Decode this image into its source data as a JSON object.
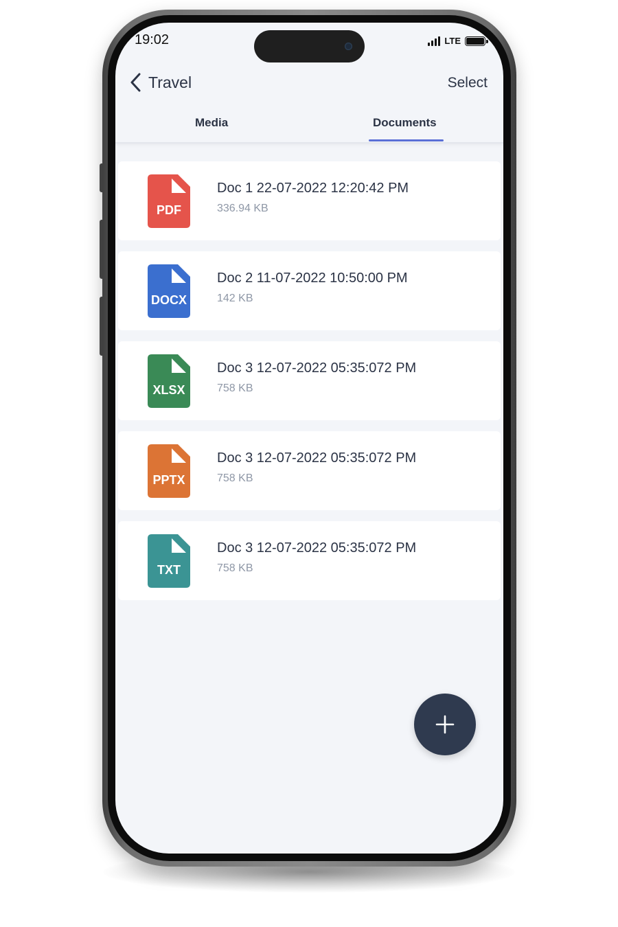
{
  "status_bar": {
    "time": "19:02",
    "network": "LTE"
  },
  "header": {
    "back_label": "Travel",
    "select_label": "Select"
  },
  "tabs": [
    {
      "label": "Media",
      "active": false
    },
    {
      "label": "Documents",
      "active": true
    }
  ],
  "documents": [
    {
      "name": "Doc 1 22-07-2022 12:20:42 PM",
      "size": "336.94 KB",
      "type": "PDF",
      "color": "#e5544b"
    },
    {
      "name": "Doc 2 11-07-2022 10:50:00 PM",
      "size": "142 KB",
      "type": "DOCX",
      "color": "#3b6fcf"
    },
    {
      "name": "Doc 3 12-07-2022 05:35:072 PM",
      "size": "758 KB",
      "type": "XLSX",
      "color": "#3a8a56"
    },
    {
      "name": "Doc 3 12-07-2022 05:35:072 PM",
      "size": "758 KB",
      "type": "PPTX",
      "color": "#dc7435"
    },
    {
      "name": "Doc 3 12-07-2022 05:35:072 PM",
      "size": "758 KB",
      "type": "TXT",
      "color": "#3b9494"
    }
  ],
  "fab": {
    "icon": "plus-icon"
  },
  "colors": {
    "accent": "#5a6fd6",
    "fab": "#2f3a4f",
    "screen_bg": "#f3f5f9",
    "text_primary": "#2b3345",
    "text_secondary": "#8e97a6"
  }
}
